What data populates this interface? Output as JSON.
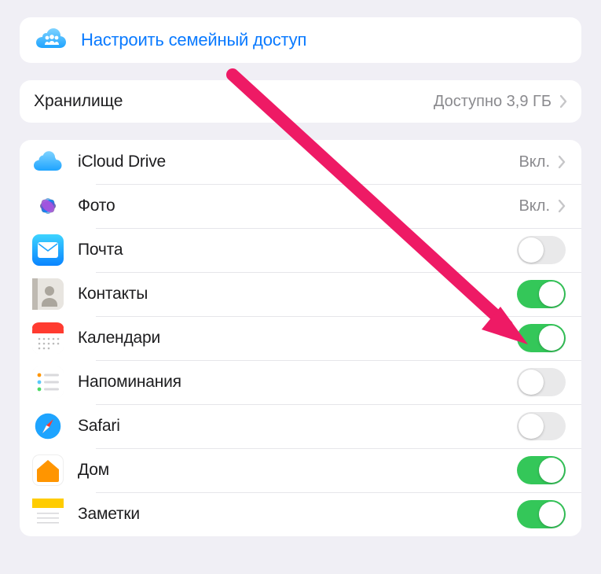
{
  "family": {
    "label": "Настроить семейный доступ"
  },
  "storage": {
    "title": "Хранилище",
    "avail": "Доступно 3,9 ГБ"
  },
  "apps": {
    "icloud_drive": {
      "label": "iCloud Drive",
      "status": "Вкл."
    },
    "photos": {
      "label": "Фото",
      "status": "Вкл."
    },
    "mail": {
      "label": "Почта"
    },
    "contacts": {
      "label": "Контакты"
    },
    "calendars": {
      "label": "Календари"
    },
    "reminders": {
      "label": "Напоминания"
    },
    "safari": {
      "label": "Safari"
    },
    "home": {
      "label": "Дом"
    },
    "notes": {
      "label": "Заметки"
    }
  },
  "colors": {
    "link": "#0a7aff",
    "toggle_on": "#34c759",
    "annotation": "#e91e63"
  }
}
